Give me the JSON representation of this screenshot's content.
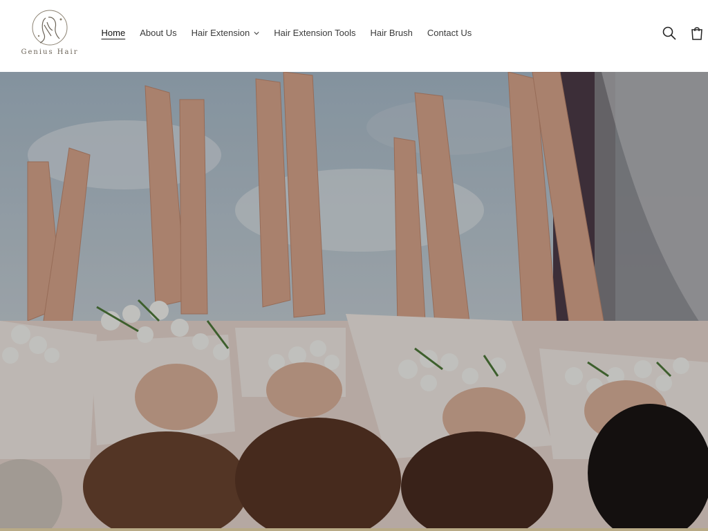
{
  "brand": {
    "name": "Genius Hair",
    "logo_icon": "woman-silhouette-icon"
  },
  "nav": {
    "items": [
      {
        "label": "Home",
        "active": true
      },
      {
        "label": "About Us",
        "active": false
      },
      {
        "label": "Hair Extension",
        "active": false,
        "has_dropdown": true
      },
      {
        "label": "Hair Extension Tools",
        "active": false
      },
      {
        "label": "Hair Brush",
        "active": false
      },
      {
        "label": "Contact Us",
        "active": false
      }
    ]
  },
  "header_icons": {
    "search": "search-icon",
    "cart": "cart-icon"
  },
  "hero": {
    "image": "women-lying-legs-up-with-white-tulips"
  },
  "colors": {
    "text": "#3a3a3a",
    "accent_band": "#b8aa86",
    "background": "#ffffff"
  }
}
